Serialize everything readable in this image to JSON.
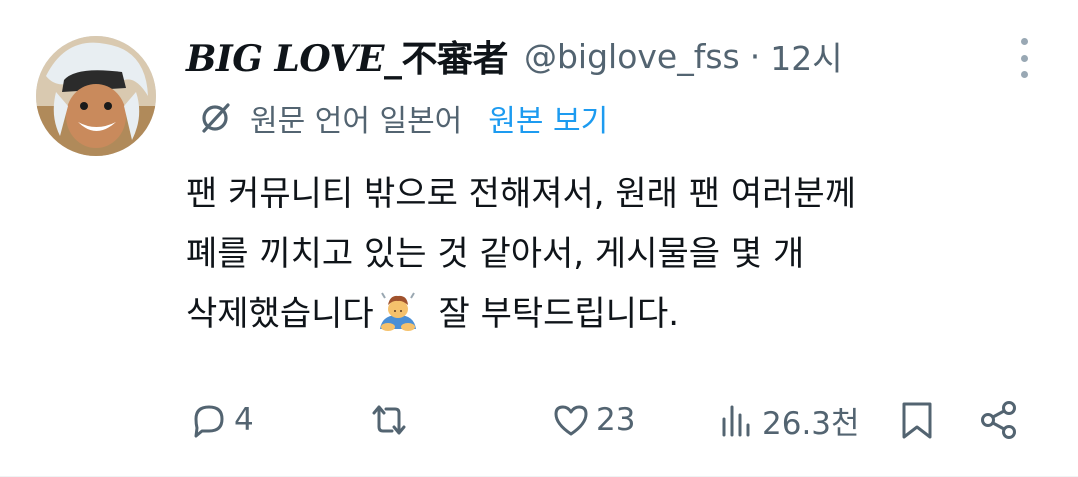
{
  "tweet": {
    "display_name_latin": "BIG LOVE_",
    "display_name_cjk": "不審者",
    "handle": "@biglove_fss",
    "separator": "·",
    "time": "12시",
    "translation_note": "원문 언어 일본어",
    "view_original": "원본 보기",
    "body_lines": [
      "팬 커뮤니티 밖으로 전해져서, 원래 팬 여러분께",
      "폐를 끼치고 있는 것 같아서, 게시물을 몇 개",
      "삭제했습니다",
      " 잘 부탁드립니다."
    ],
    "emoji_name": "person-bowing-emoji"
  },
  "actions": {
    "reply_count": "4",
    "repost_count": "",
    "like_count": "23",
    "views_count": "26.3천"
  },
  "icons": {
    "more": "more-vertical-icon",
    "translate": "translate-icon",
    "reply": "reply-icon",
    "repost": "repost-icon",
    "like": "heart-icon",
    "views": "views-icon",
    "bookmark": "bookmark-icon",
    "share": "share-icon"
  },
  "colors": {
    "text": "#0f1419",
    "secondary": "#536471",
    "link": "#1d9bf0",
    "icon": "#536471"
  }
}
